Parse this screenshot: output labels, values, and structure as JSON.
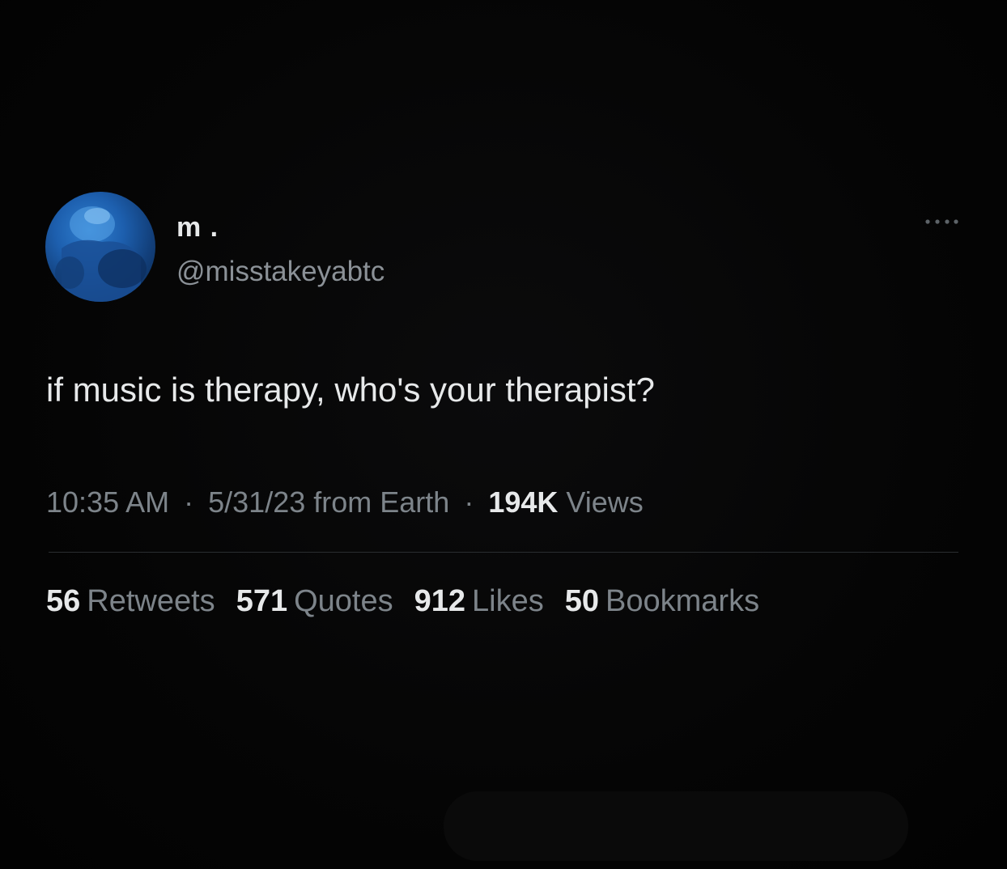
{
  "tweet": {
    "display_name": "m .",
    "handle": "@misstakeyabtc",
    "text": "if music is therapy, who's your therapist?",
    "time": "10:35 AM",
    "separator": "·",
    "date_source": "5/31/23 from Earth",
    "views_count": "194K",
    "views_label": "Views"
  },
  "stats": [
    {
      "count": "56",
      "label": "Retweets"
    },
    {
      "count": "571",
      "label": "Quotes"
    },
    {
      "count": "912",
      "label": "Likes"
    },
    {
      "count": "50",
      "label": "Bookmarks"
    }
  ],
  "icons": {
    "more": "more-horizontal-icon"
  },
  "colors": {
    "background": "#040404",
    "primary_text": "#e7e9ea",
    "secondary_text": "#7d848a",
    "avatar_blue": "#1d5fae"
  }
}
